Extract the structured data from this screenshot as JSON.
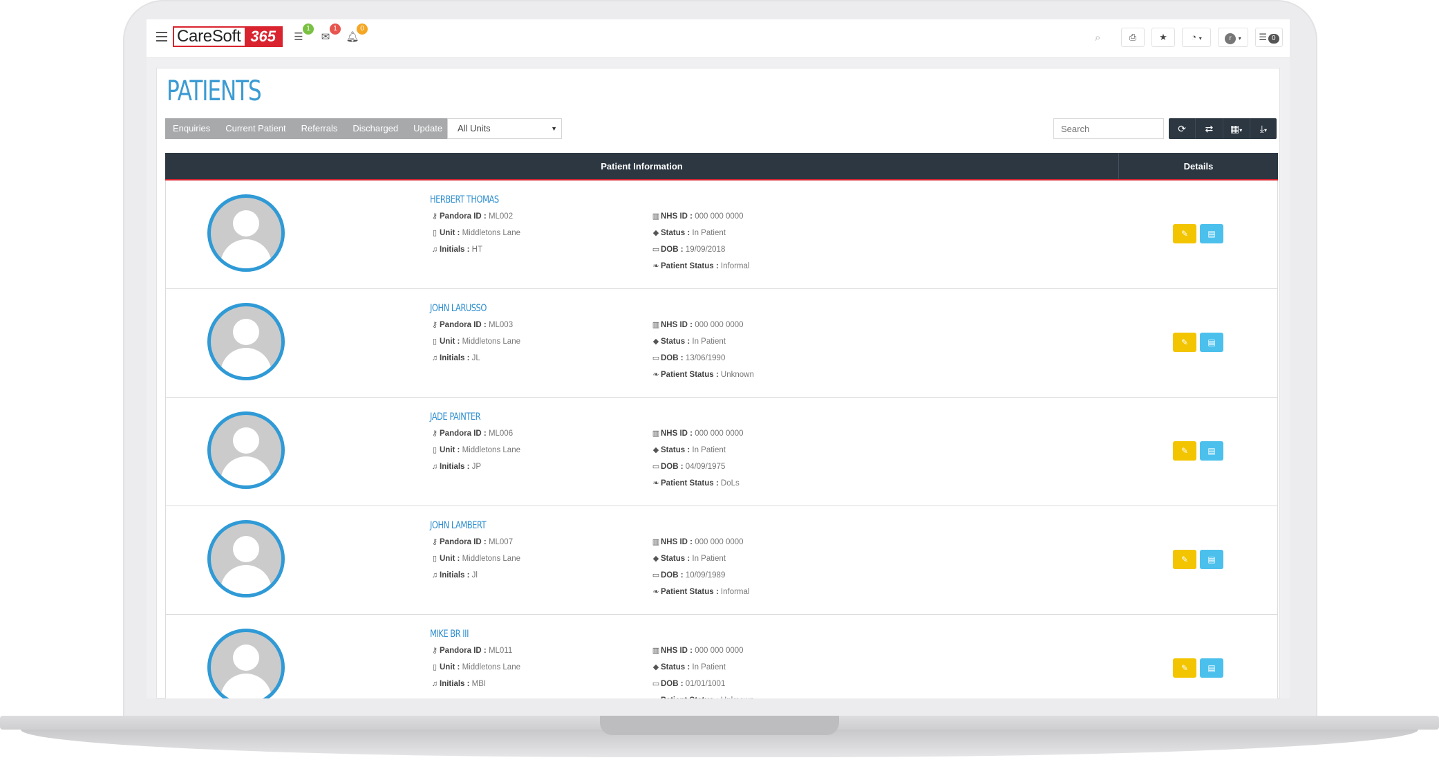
{
  "app": {
    "logo_text": "CareSoft",
    "logo_number": "365"
  },
  "topbar": {
    "badges": {
      "tasks": "1",
      "messages": "1",
      "alerts": "0"
    },
    "user_initial": "r",
    "counter": "0"
  },
  "page": {
    "title": "PATIENTS"
  },
  "tabs": [
    {
      "label": "Enquiries"
    },
    {
      "label": "Current Patient"
    },
    {
      "label": "Referrals"
    },
    {
      "label": "Discharged"
    },
    {
      "label": "Update"
    }
  ],
  "unit_filter": {
    "selected": "All Units"
  },
  "search": {
    "placeholder": "Search"
  },
  "table": {
    "headers": {
      "info": "Patient Information",
      "details": "Details"
    },
    "labels": {
      "pandora_id": "Pandora ID :",
      "unit": "Unit :",
      "initials": "Initials :",
      "nhs_id": "NHS ID :",
      "status": "Status :",
      "dob": "DOB :",
      "patient_status": "Patient Status :"
    },
    "rows": [
      {
        "name": "HERBERT THOMAS",
        "pandora_id": "ML002",
        "unit": "Middletons Lane",
        "initials": "HT",
        "nhs_id": "000 000 0000",
        "status": "In Patient",
        "dob": "19/09/2018",
        "patient_status": "Informal"
      },
      {
        "name": "JOHN LARUSSO",
        "pandora_id": "ML003",
        "unit": "Middletons Lane",
        "initials": "JL",
        "nhs_id": "000 000 0000",
        "status": "In Patient",
        "dob": "13/06/1990",
        "patient_status": "Unknown"
      },
      {
        "name": "JADE PAINTER",
        "pandora_id": "ML006",
        "unit": "Middletons Lane",
        "initials": "JP",
        "nhs_id": "000 000 0000",
        "status": "In Patient",
        "dob": "04/09/1975",
        "patient_status": "DoLs"
      },
      {
        "name": "JOHN LAMBERT",
        "pandora_id": "ML007",
        "unit": "Middletons Lane",
        "initials": "Jl",
        "nhs_id": "000 000 0000",
        "status": "In Patient",
        "dob": "10/09/1989",
        "patient_status": "Informal"
      },
      {
        "name": "MIKE BR III",
        "pandora_id": "ML011",
        "unit": "Middletons Lane",
        "initials": "MBI",
        "nhs_id": "000 000 0000",
        "status": "In Patient",
        "dob": "01/01/1001",
        "patient_status": "Unknown"
      }
    ]
  },
  "colors": {
    "accent_blue": "#2f9ad6",
    "header_dark": "#2c3742",
    "brand_red": "#d9232e",
    "edit_yellow": "#f2c500",
    "doc_blue": "#4cc0ec"
  }
}
